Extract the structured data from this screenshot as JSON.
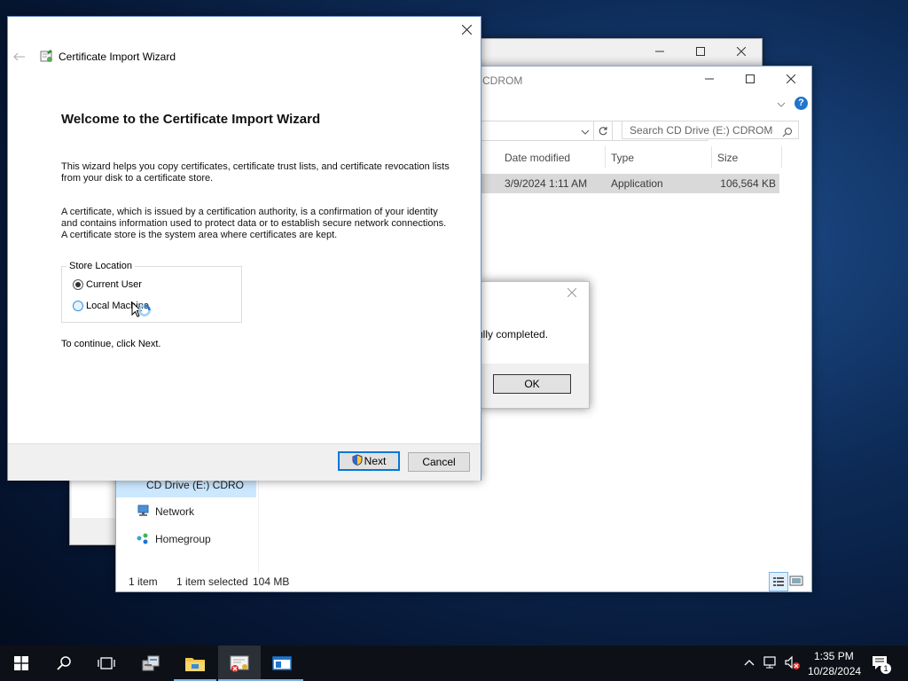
{
  "explorer_back": {
    "window_controls": [
      "minimize",
      "maximize",
      "close"
    ]
  },
  "explorer": {
    "title": "CDROM",
    "search_placeholder": "Search CD Drive (E:) CDROM",
    "columns": [
      "Date modified",
      "Type",
      "Size"
    ],
    "row": {
      "date": "3/9/2024 1:11 AM",
      "type": "Application",
      "size": "106,564 KB"
    },
    "nav": {
      "drive": "CD Drive (E:) CDRO",
      "network": "Network",
      "homegroup": "Homegroup"
    },
    "status": {
      "items": "1 item",
      "selected": "1 item selected",
      "size": "104 MB"
    }
  },
  "msgbox": {
    "text": "ully completed.",
    "ok_label": "OK"
  },
  "wizard": {
    "title": "Certificate Import Wizard",
    "heading": "Welcome to the Certificate Import Wizard",
    "para1": "This wizard helps you copy certificates, certificate trust lists, and certificate revocation lists from your disk to a certificate store.",
    "para2": "A certificate, which is issued by a certification authority, is a confirmation of your identity and contains information used to protect data or to establish secure network connections. A certificate store is the system area where certificates are kept.",
    "store_location_label": "Store Location",
    "options": [
      "Current User",
      "Local Machine"
    ],
    "selected_option": "Current User",
    "continue_text": "To continue, click Next.",
    "next_label": "Next",
    "cancel_label": "Cancel"
  },
  "taskbar": {
    "items": [
      "start-icon",
      "search-icon",
      "task-view-icon",
      "server-manager-icon",
      "file-explorer-icon",
      "certificate-app-icon",
      "app-window-icon"
    ],
    "active": "certificate-app-icon",
    "time": "1:35 PM",
    "date": "10/28/2024",
    "notification_count": "1"
  },
  "colors": {
    "accent": "#0078d7",
    "selection": "#d9d9d9",
    "taskbar": "#0d1117"
  }
}
